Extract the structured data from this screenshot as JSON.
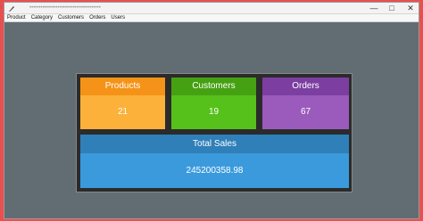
{
  "window": {
    "title": "••••••••••••••••••••••••••••••••••••••",
    "minimize": "—",
    "maximize": "□",
    "close": "✕",
    "app_icon": "feather-icon"
  },
  "menu": {
    "items": [
      "Product",
      "Category",
      "Customers",
      "Orders",
      "Users"
    ]
  },
  "cards": {
    "products": {
      "label": "Products",
      "value": "21"
    },
    "customers": {
      "label": "Customers",
      "value": "19"
    },
    "orders": {
      "label": "Orders",
      "value": "67"
    },
    "sales": {
      "label": "Total Sales",
      "value": "245200358.98"
    }
  },
  "colors": {
    "background": "#616d72",
    "products": "#f49318",
    "customers": "#45a112",
    "orders": "#7c3ea0",
    "sales": "#2f7fb9"
  }
}
